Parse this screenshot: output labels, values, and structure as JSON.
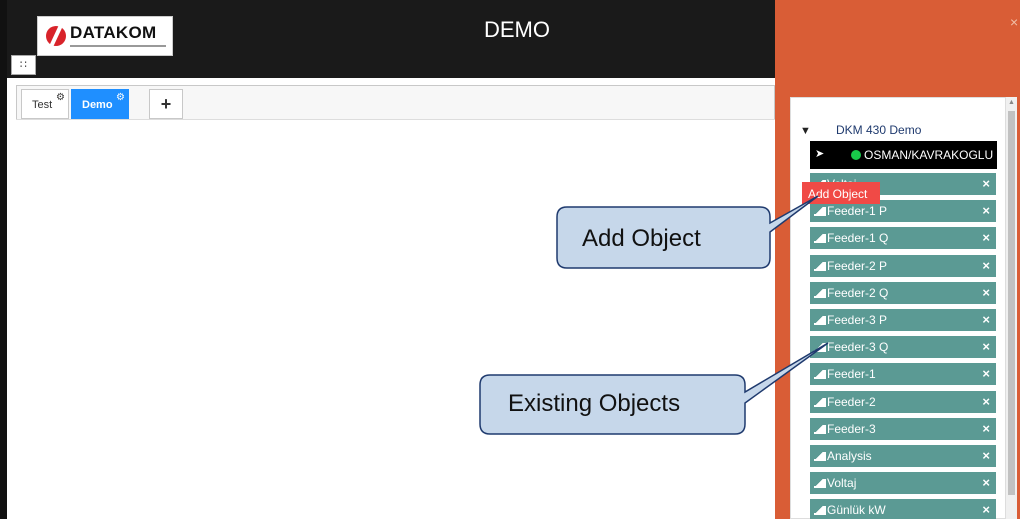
{
  "header": {
    "logo_text": "DATAKOM",
    "grid_icon": "grid-icon",
    "title": "DEMO"
  },
  "tabs": [
    {
      "label": "Test",
      "icon": "gear-icon",
      "active": false
    },
    {
      "label": "Demo",
      "icon": "gear-icon",
      "active": true
    }
  ],
  "add_tab_label": "+",
  "panel": {
    "close_label": "×",
    "tree": {
      "root_label": "DKM 430 Demo",
      "root_icon": "triangle-down-icon",
      "device": {
        "name": "OSMAN/KAVRAKOGLU",
        "status_color": "#19c84a"
      },
      "objects": [
        {
          "label": "Voltaj"
        },
        {
          "label": "Feeder-1 P"
        },
        {
          "label": "Feeder-1 Q"
        },
        {
          "label": "Feeder-2 P"
        },
        {
          "label": "Feeder-2 Q"
        },
        {
          "label": "Feeder-3 P"
        },
        {
          "label": "Feeder-3 Q"
        },
        {
          "label": "Feeder-1"
        },
        {
          "label": "Feeder-2"
        },
        {
          "label": "Feeder-3"
        },
        {
          "label": "Analysis"
        },
        {
          "label": "Voltaj"
        },
        {
          "label": "Günlük kW"
        }
      ],
      "delete_label": "×"
    }
  },
  "tooltip": {
    "label": "Add Object"
  },
  "callouts": {
    "add_object": "Add Object",
    "existing_objects": "Existing Objects"
  },
  "colors": {
    "accent_orange": "#d95d36",
    "object_teal": "#5b9a94",
    "active_tab_blue": "#1f8fff",
    "tooltip_red": "#f04a46"
  }
}
